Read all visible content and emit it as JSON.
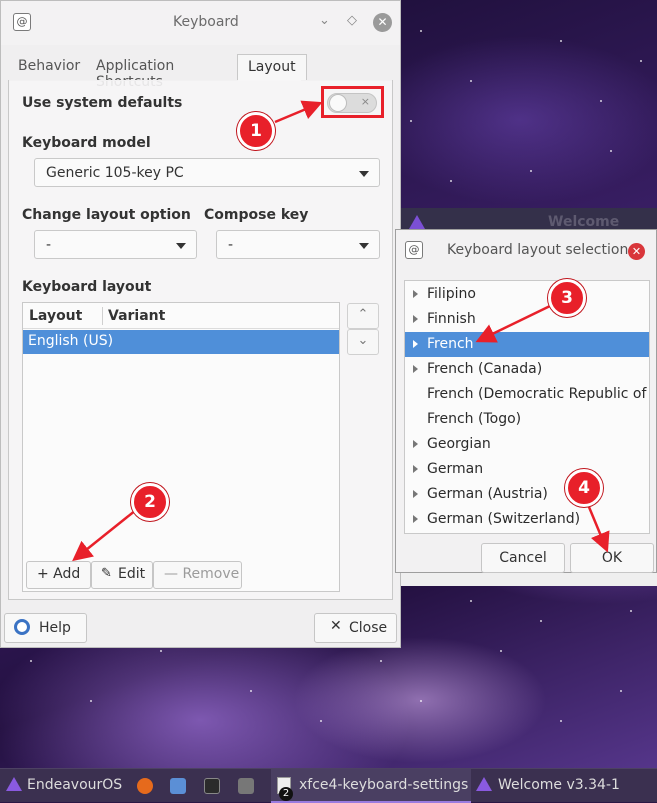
{
  "keyboard_window": {
    "title": "Keyboard",
    "tabs": [
      "Behavior",
      "Application Shortcuts",
      "Layout"
    ],
    "use_system_defaults_label": "Use system defaults",
    "toggle_x": "×",
    "keyboard_model_label": "Keyboard model",
    "keyboard_model_value": "Generic 105-key PC",
    "change_layout_label": "Change layout option",
    "change_layout_value": "-",
    "compose_key_label": "Compose key",
    "compose_key_value": "-",
    "keyboard_layout_label": "Keyboard layout",
    "columns": [
      "Layout",
      "Variant"
    ],
    "rows": [
      "English (US)"
    ],
    "buttons": {
      "add": "+ Add",
      "edit": "Edit",
      "remove": "— Remove"
    },
    "help": "Help",
    "close": "Close"
  },
  "welcome_window": {
    "title": "Welcome v3.34-1"
  },
  "layout_dialog": {
    "title": "Keyboard layout selection",
    "items": [
      {
        "label": "Filipino",
        "expandable": true
      },
      {
        "label": "Finnish",
        "expandable": true
      },
      {
        "label": "French",
        "expandable": true,
        "selected": true
      },
      {
        "label": "French (Canada)",
        "expandable": true
      },
      {
        "label": "French (Democratic Republic of the C",
        "expandable": false
      },
      {
        "label": "French (Togo)",
        "expandable": false
      },
      {
        "label": "Georgian",
        "expandable": true
      },
      {
        "label": "German",
        "expandable": true
      },
      {
        "label": "German (Austria)",
        "expandable": true
      },
      {
        "label": "German (Switzerland)",
        "expandable": true
      }
    ],
    "cancel": "Cancel",
    "ok": "OK"
  },
  "annotations": [
    "1",
    "2",
    "3",
    "4"
  ],
  "taskbar": {
    "start": "EndeavourOS",
    "items": [
      "xfce4-keyboard-settings",
      "Welcome v3.34-1"
    ],
    "badge": "2"
  },
  "colors": {
    "accent": "#4f8fd9",
    "annotation_red": "#e8202a"
  }
}
